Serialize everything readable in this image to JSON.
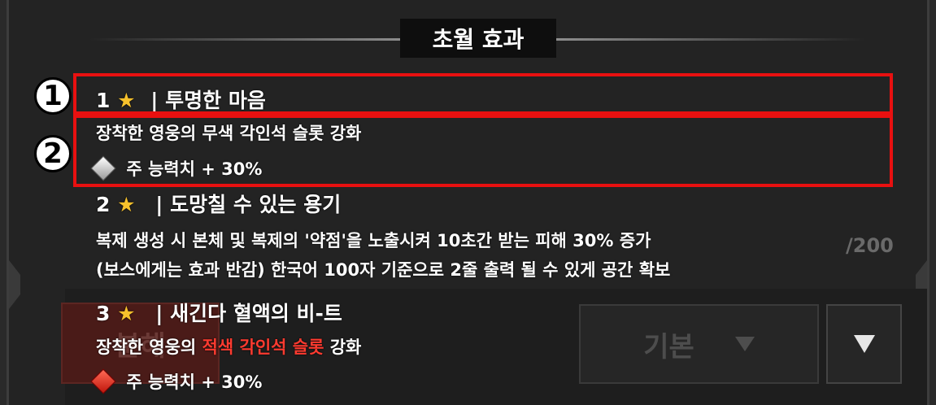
{
  "header": {
    "title": "초월 효과"
  },
  "background_ui": {
    "counter": "/200",
    "disassemble_label": "분해",
    "filter_label": "기본",
    "filter_icon": "funnel-icon",
    "dropdown_icon": "triangle-down-icon"
  },
  "effects": [
    {
      "level": "1",
      "name": "투명한 마음",
      "description": "장착한 영웅의 무색 각인석 슬롯 강화",
      "bonus": "주 능력치 + 30%",
      "gem_color": "#d8d8d8"
    },
    {
      "level": "2",
      "name": "도망칠 수 있는 용기",
      "description_line1": "복제 생성 시 본체 및 복제의 '약점'을 노출시켜 10초간 받는 피해 30% 증가",
      "description_line2": "(보스에게는 효과 반감) 한국어 100자 기준으로 2줄 출력 될 수 있게 공간 확보"
    },
    {
      "level": "3",
      "name": "새긴다 혈액의 비-트",
      "description_prefix": "장착한 영웅의",
      "description_highlight": "적색 각인석 슬롯",
      "description_suffix": "강화",
      "bonus": "주 능력치 + 30%",
      "gem_color": "#e02a1e",
      "highlight_color": "#ff3b30"
    }
  ],
  "labels": {
    "star": "★",
    "separator": "|"
  },
  "annotations": [
    {
      "number": "1"
    },
    {
      "number": "2"
    }
  ],
  "colors": {
    "annotation": "#e81010",
    "star": "#f6c12c"
  }
}
